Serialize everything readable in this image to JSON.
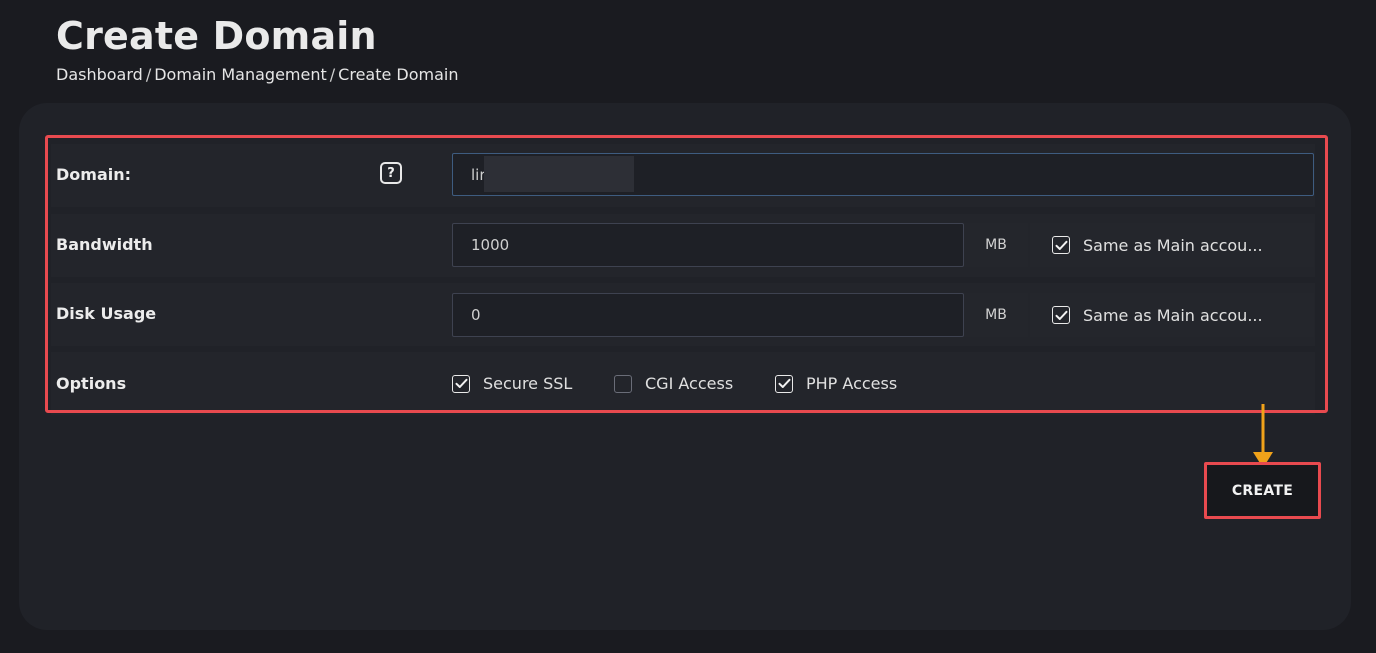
{
  "header": {
    "title": "Create Domain",
    "breadcrumb": [
      "Dashboard",
      "Domain Management",
      "Create Domain"
    ],
    "breadcrumb_separator": "/"
  },
  "form": {
    "domain": {
      "label": "Domain:",
      "value": "lir",
      "help_icon": "question-icon"
    },
    "bandwidth": {
      "label": "Bandwidth",
      "value": "1000",
      "unit": "MB",
      "same_as_main": {
        "label": "Same as Main accou...",
        "checked": true
      }
    },
    "disk_usage": {
      "label": "Disk Usage",
      "value": "0",
      "unit": "MB",
      "same_as_main": {
        "label": "Same as Main accou...",
        "checked": true
      }
    },
    "options": {
      "label": "Options",
      "items": [
        {
          "label": "Secure SSL",
          "checked": true
        },
        {
          "label": "CGI Access",
          "checked": false
        },
        {
          "label": "PHP Access",
          "checked": true
        }
      ]
    }
  },
  "actions": {
    "create_label": "CREATE"
  },
  "colors": {
    "highlight": "#e84a4f",
    "arrow": "#f0a21a",
    "background": "#1a1b20",
    "card": "#202228"
  }
}
